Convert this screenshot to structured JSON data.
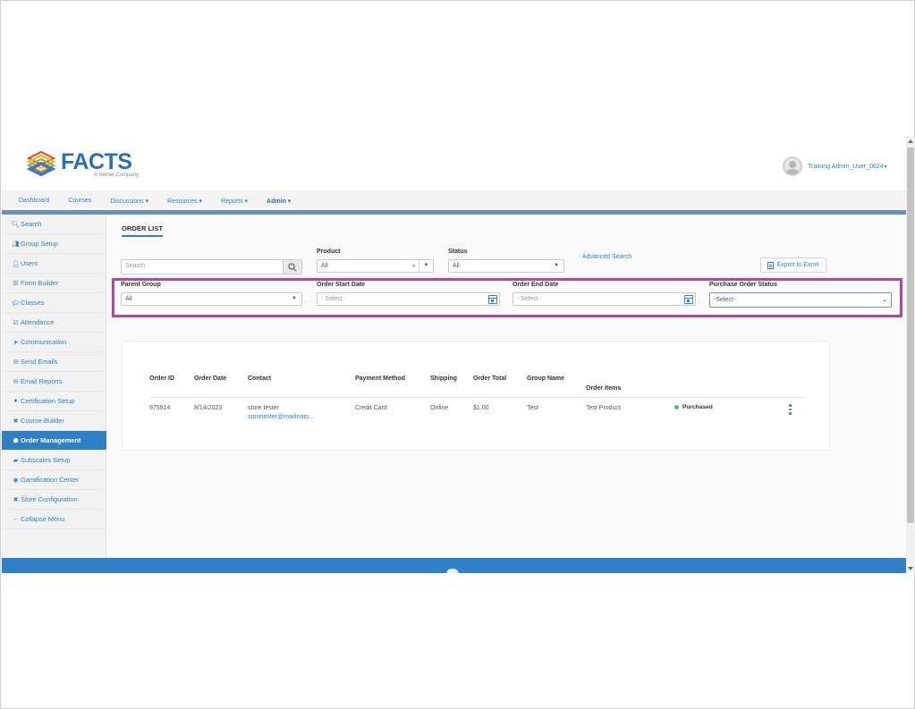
{
  "brand": {
    "name": "FACTS",
    "tagline": "A Nelnet Company"
  },
  "user": {
    "display_name": "Training Admin_User_0624",
    "menu_caret": "▾"
  },
  "nav": {
    "items": [
      {
        "label": "Dashboard"
      },
      {
        "label": "Courses"
      },
      {
        "label": "Discussions ▾"
      },
      {
        "label": "Resources ▾"
      },
      {
        "label": "Reports ▾"
      },
      {
        "label": "Admin ▾",
        "active": true
      }
    ]
  },
  "sidebar": {
    "items": [
      {
        "icon": "search-icon",
        "glyph": "🔍︎",
        "label": "Search"
      },
      {
        "icon": "group-icon",
        "glyph": "👥︎",
        "label": "Group Setup"
      },
      {
        "icon": "user-icon",
        "glyph": "👤︎",
        "label": "Users"
      },
      {
        "icon": "list-icon",
        "glyph": "☰",
        "label": "Form Builder"
      },
      {
        "icon": "graduation-cap-icon",
        "glyph": "🎓︎",
        "label": "Classes"
      },
      {
        "icon": "checkbox-icon",
        "glyph": "☑",
        "label": "Attendance"
      },
      {
        "icon": "send-icon",
        "glyph": "➤",
        "label": "Communication"
      },
      {
        "icon": "envelope-icon",
        "glyph": "✉",
        "label": "Send Emails"
      },
      {
        "icon": "email-report-icon",
        "glyph": "✉",
        "label": "Email Reports"
      },
      {
        "icon": "certificate-icon",
        "glyph": "●",
        "label": "Certification Setup"
      },
      {
        "icon": "tools-icon",
        "glyph": "✖",
        "label": "Course Builder"
      },
      {
        "icon": "box-icon",
        "glyph": "⬢",
        "label": "Order Management",
        "active": true
      },
      {
        "icon": "car-icon",
        "glyph": "▰",
        "label": "Subscales Setup"
      },
      {
        "icon": "gamepad-icon",
        "glyph": "◉",
        "label": "Gamification Center"
      },
      {
        "icon": "tools-icon",
        "glyph": "✖",
        "label": "Store Configuration"
      },
      {
        "icon": "arrow-left-icon",
        "glyph": "←",
        "label": "Collapse Menu"
      }
    ]
  },
  "page": {
    "tab_label": "ORDER LIST"
  },
  "filters": {
    "search_placeholder": "Search",
    "product_label": "Product",
    "product_value": "All",
    "status_label": "Status",
    "status_value": "All",
    "advanced_search": "- Advanced Search",
    "export_label": "Export to Excel",
    "parent_group_label": "Parent Group",
    "parent_group_value": "All",
    "order_start_label": "Order Start Date",
    "order_start_placeholder": "- Select -",
    "order_end_label": "Order End Date",
    "order_end_placeholder": "- Select -",
    "po_status_label": "Purchase Order Status",
    "po_status_value": "-Select-"
  },
  "orders_table": {
    "columns": [
      "Order ID",
      "Order Date",
      "Contact",
      "Payment Method",
      "Shipping",
      "Order Total",
      "Group Name",
      "Order Items"
    ],
    "rows": [
      {
        "order_id": "975914",
        "order_date": "8/14/2023",
        "contact_name": "store tester",
        "contact_email": "storetester@mailinato...",
        "payment_method": "Credit Card",
        "shipping": "Online",
        "order_total": "$1.00",
        "group_name": "Test",
        "order_items": "Test Product",
        "status": "Purchased",
        "status_color": "#5cb85c"
      }
    ]
  },
  "colors": {
    "accent": "#2f80c7",
    "highlight": "#b3479e"
  }
}
